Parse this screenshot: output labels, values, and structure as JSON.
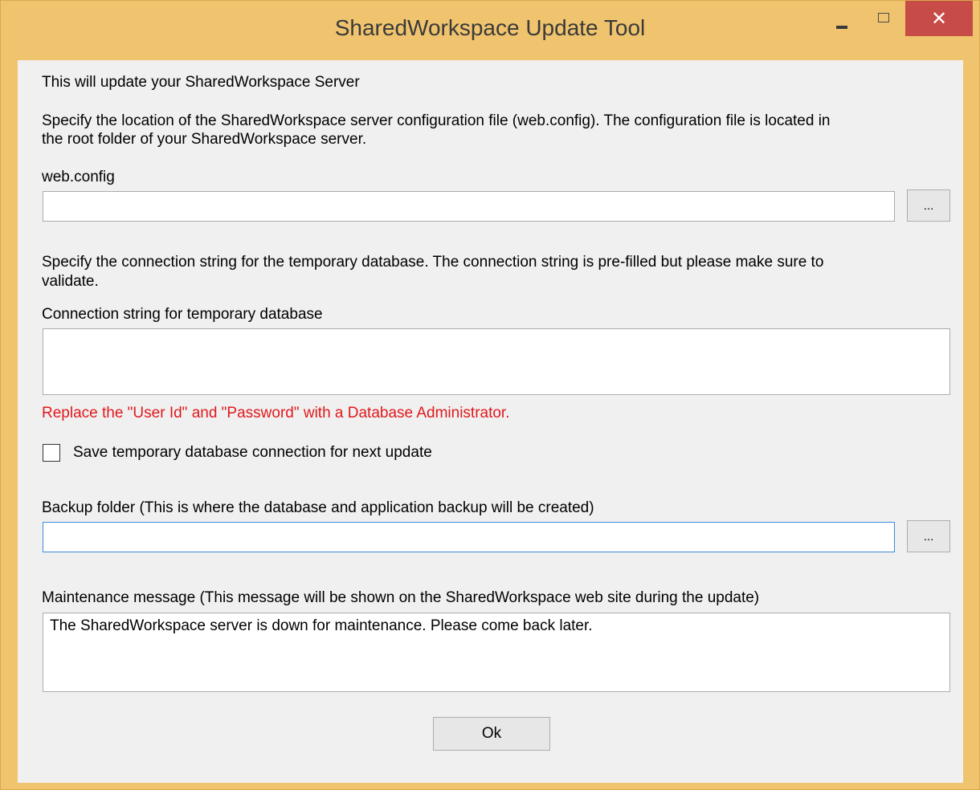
{
  "window": {
    "title": "SharedWorkspace Update Tool",
    "close_glyph": "✕",
    "accent_color": "#f0c46e",
    "close_color": "#c74b46"
  },
  "intro": "This will update your SharedWorkspace Server",
  "webconfig": {
    "description_line1": "Specify the location of the SharedWorkspace server configuration file (web.config). The configuration file is located in",
    "description_line2": "the root folder of your SharedWorkspace server.",
    "label": "web.config",
    "value": "",
    "browse_label": "..."
  },
  "connection": {
    "description_line1": "Specify the connection string for the temporary database. The connection string is pre-filled but please make sure to",
    "description_line2": "validate.",
    "label": "Connection string for temporary database",
    "value": "",
    "warning": "Replace the \"User Id\" and \"Password\" with a Database Administrator.",
    "warning_color": "#e0191d"
  },
  "save_connection": {
    "label": "Save temporary database connection for next update",
    "checked": false
  },
  "backup": {
    "label": "Backup folder (This is where the database and application backup will be created)",
    "value": "",
    "browse_label": "..."
  },
  "maintenance": {
    "label": "Maintenance message (This message will be shown on the SharedWorkspace web site during the update)",
    "value": "The SharedWorkspace server is down for maintenance. Please come back later."
  },
  "ok_label": "Ok",
  "icons": {
    "minimize": "minimize-icon",
    "maximize": "maximize-icon",
    "close": "close-icon"
  }
}
